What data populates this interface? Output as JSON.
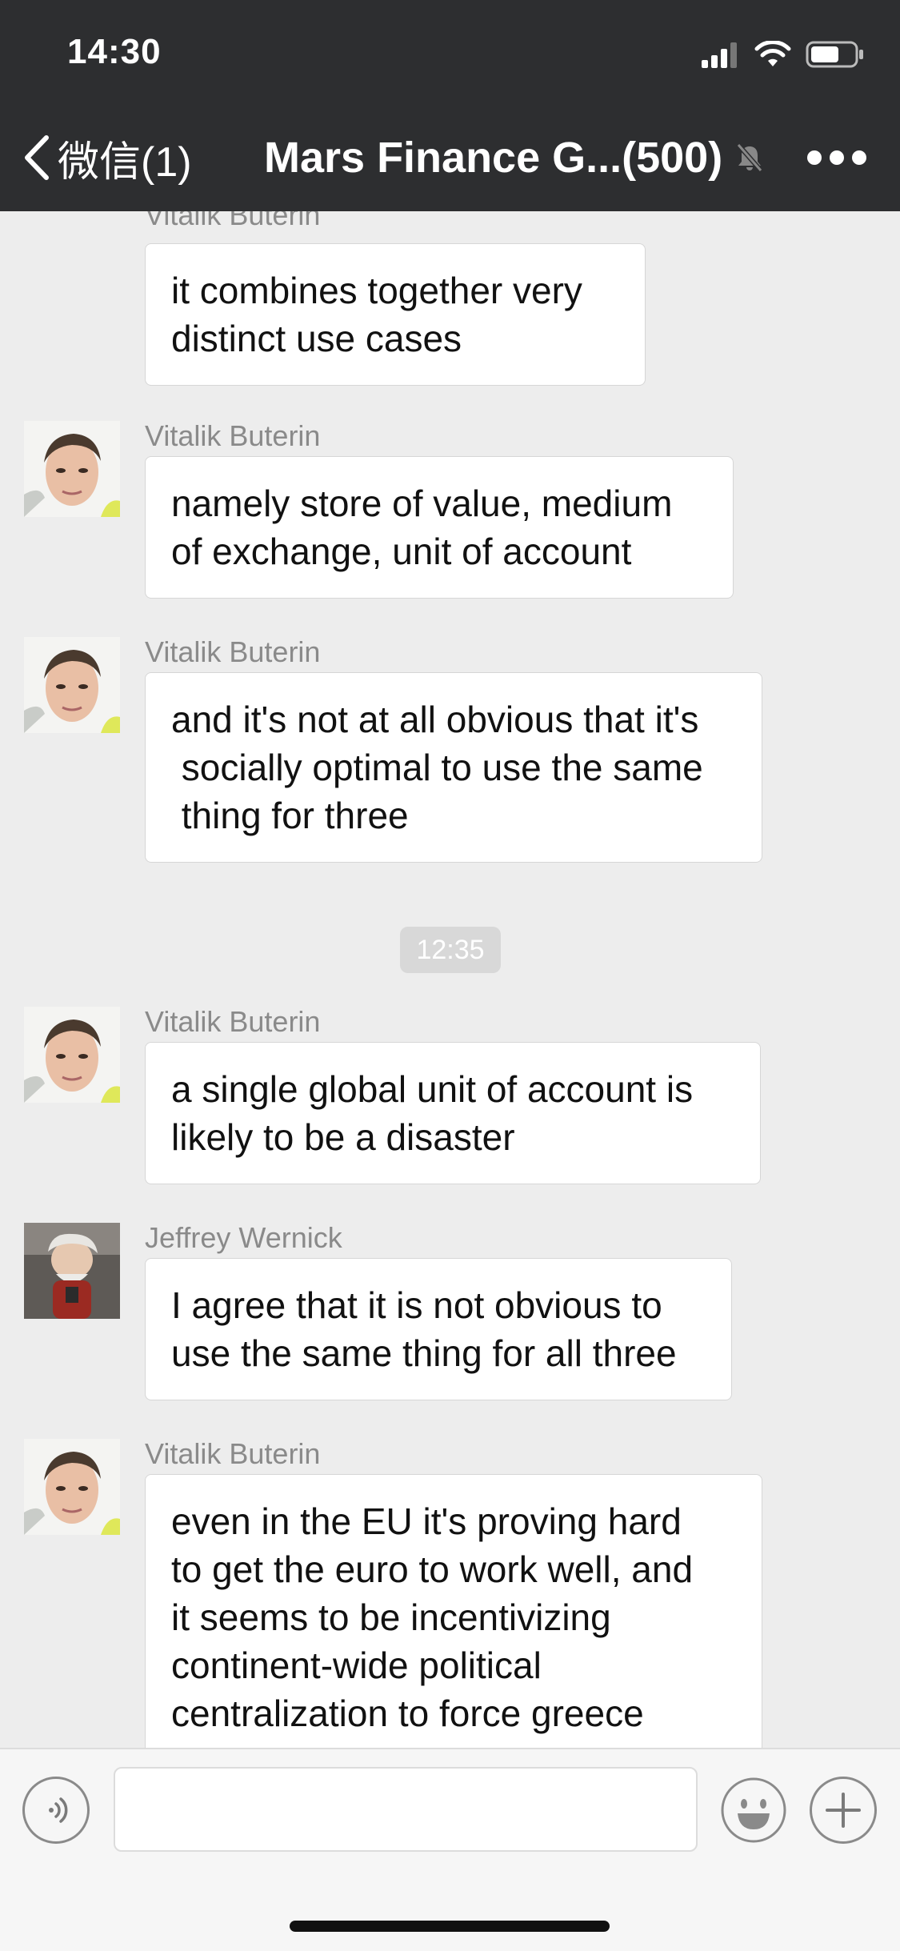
{
  "status_bar": {
    "time": "14:30"
  },
  "nav": {
    "back_label": "微信(1)",
    "title": "Mars Finance G...(500)",
    "icons": [
      "chevron-left-icon",
      "mute-bell-icon",
      "more-icon"
    ]
  },
  "messages": [
    {
      "sender": "Vitalik Buterin",
      "text": "it combines together very\ndistinct use cases",
      "avatar": "vitalik"
    },
    {
      "sender": "Vitalik Buterin",
      "text": "namely store of value, medium\nof exchange, unit of account",
      "avatar": "vitalik"
    },
    {
      "sender": "Vitalik Buterin",
      "text": "and it's not at all obvious that it's\n socially optimal to use the same\n thing for three",
      "avatar": "vitalik"
    },
    {
      "sender": "Vitalik Buterin",
      "text": "a single global unit of account is\nlikely to be a disaster",
      "avatar": "vitalik"
    },
    {
      "sender": "Jeffrey Wernick",
      "text": "I agree that it is not obvious to\nuse the same thing for all three",
      "avatar": "jeffrey"
    },
    {
      "sender": "Vitalik Buterin",
      "text": "even in the EU it's proving hard\nto get the euro to work well, and\nit seems to be incentivizing\ncontinent-wide political\ncentralization to force greece",
      "avatar": "vitalik"
    }
  ],
  "time_divider": "12:35",
  "input_bar": {
    "placeholder": "",
    "icons": [
      "voice-icon",
      "emoji-icon",
      "plus-icon"
    ]
  },
  "colors": {
    "header_bg": "#2d2e30",
    "chat_bg": "#ededed",
    "bubble_bg": "#ffffff"
  }
}
